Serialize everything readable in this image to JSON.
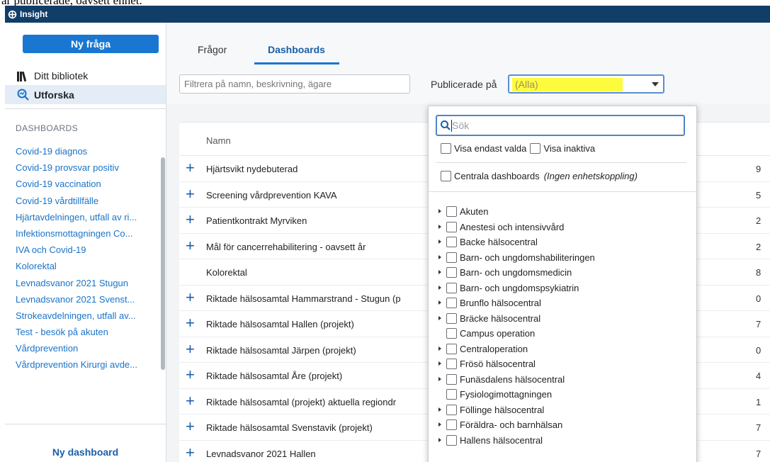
{
  "doc_caption": "är publicerade, oavsett enhet.",
  "app": {
    "title": "Insight"
  },
  "sidebar": {
    "new_question": "Ny fråga",
    "library": "Ditt bibliotek",
    "explore": "Utforska",
    "section": "DASHBOARDS",
    "items": [
      "Covid-19 diagnos",
      "Covid-19 provsvar positiv",
      "Covid-19 vaccination",
      "Covid-19 vårdtillfälle",
      "Hjärtavdelningen, utfall av ri...",
      "Infektionsmottagningen Co...",
      "IVA och Covid-19",
      "Kolorektal",
      "Levnadsvanor 2021 Stugun",
      "Levnadsvanor 2021 Svenst...",
      "Strokeavdelningen, utfall av...",
      "Test - besök på akuten",
      "Vårdprevention",
      "Vårdprevention Kirurgi avde..."
    ],
    "new_dashboard": "Ny dashboard"
  },
  "tabs": {
    "questions": "Frågor",
    "dashboards": "Dashboards"
  },
  "filter": {
    "placeholder": "Filtrera på namn, beskrivning, ägare",
    "published_label": "Publicerade på",
    "published_value": "(Alla)"
  },
  "table": {
    "col_name": "Namn",
    "rows": [
      {
        "name": "Hjärtsvikt nydebuterad",
        "num": "9",
        "plus": "+"
      },
      {
        "name": "Screening vårdprevention KAVA",
        "num": "5",
        "plus": "+"
      },
      {
        "name": "Patientkontrakt Myrviken",
        "num": "2",
        "plus": "+"
      },
      {
        "name": "Mål för cancerrehabilitering - oavsett år",
        "num": "2",
        "plus": "+"
      },
      {
        "name": "Kolorektal",
        "num": "8",
        "plus": ""
      },
      {
        "name": "Riktade hälsosamtal Hammarstrand - Stugun (p",
        "num": "0",
        "plus": "+"
      },
      {
        "name": "Riktade hälsosamtal Hallen (projekt)",
        "num": "7",
        "plus": "+"
      },
      {
        "name": "Riktade hälsosamtal Järpen (projekt)",
        "num": "0",
        "plus": "+"
      },
      {
        "name": "Riktade hälsosamtal Åre (projekt)",
        "num": "4",
        "plus": "+"
      },
      {
        "name": "Riktade hälsosamtal (projekt) aktuella regiondr",
        "num": "1",
        "plus": "+"
      },
      {
        "name": "Riktade hälsosamtal Svenstavik (projekt)",
        "num": "7",
        "plus": "+"
      },
      {
        "name": "Levnadsvanor 2021 Hallen",
        "num": "7",
        "plus": "+"
      }
    ]
  },
  "dropdown": {
    "search_placeholder": "Sök",
    "only_selected": "Visa endast valda",
    "show_inactive": "Visa inaktiva",
    "central": "Centrala dashboards",
    "central_note": "(Ingen enhetskoppling)",
    "units": [
      {
        "label": "Akuten",
        "expand": true
      },
      {
        "label": "Anestesi och intensivvård",
        "expand": true
      },
      {
        "label": "Backe hälsocentral",
        "expand": true
      },
      {
        "label": "Barn- och ungdomshabiliteringen",
        "expand": true
      },
      {
        "label": "Barn- och ungdomsmedicin",
        "expand": true
      },
      {
        "label": "Barn- och ungdomspsykiatrin",
        "expand": true
      },
      {
        "label": "Brunflo hälsocentral",
        "expand": true
      },
      {
        "label": "Bräcke hälsocentral",
        "expand": true
      },
      {
        "label": "Campus operation",
        "expand": false
      },
      {
        "label": "Centraloperation",
        "expand": true
      },
      {
        "label": "Frösö hälsocentral",
        "expand": true
      },
      {
        "label": "Funäsdalens hälsocentral",
        "expand": true
      },
      {
        "label": "Fysiologimottagningen",
        "expand": false
      },
      {
        "label": "Föllinge hälsocentral",
        "expand": true
      },
      {
        "label": "Föräldra- och barnhälsan",
        "expand": true
      },
      {
        "label": "Hallens hälsocentral",
        "expand": true
      }
    ]
  }
}
